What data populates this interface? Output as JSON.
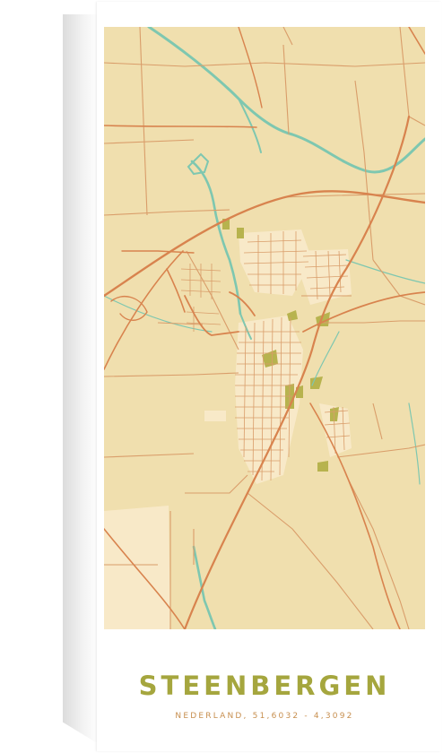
{
  "poster": {
    "city": "STEENBERGEN",
    "location_line": "NEDERLAND, 51,6032 - 4,3092"
  },
  "colors": {
    "land": "#f0dfae",
    "major_road": "#d8834e",
    "minor_road": "#d99d6a",
    "water": "#7ec7b0",
    "park": "#b7b34e",
    "built": "#f8e9c8",
    "title": "#a5a63e",
    "subtitle": "#c78f4f"
  }
}
